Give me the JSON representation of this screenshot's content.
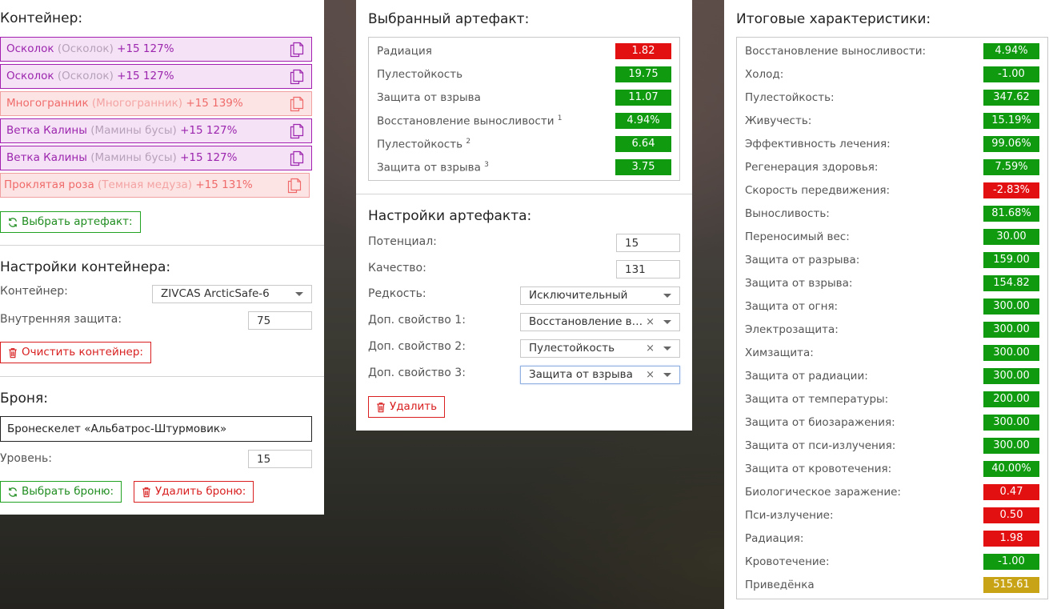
{
  "container": {
    "title": "Контейнер:",
    "artifacts": [
      {
        "name": "Осколок",
        "sub": "(Осколок)",
        "bonus": "+15 127%",
        "style": "purple"
      },
      {
        "name": "Осколок",
        "sub": "(Осколок)",
        "bonus": "+15 127%",
        "style": "purple"
      },
      {
        "name": "Многогранник",
        "sub": "(Многогранник)",
        "bonus": "+15 139%",
        "style": "pink"
      },
      {
        "name": "Ветка Калины",
        "sub": "(Мамины бусы)",
        "bonus": "+15 127%",
        "style": "purple"
      },
      {
        "name": "Ветка Калины",
        "sub": "(Мамины бусы)",
        "bonus": "+15 127%",
        "style": "purple"
      },
      {
        "name": "Проклятая роза",
        "sub": "(Темная медуза)",
        "bonus": "+15 131%",
        "style": "pink"
      }
    ],
    "select_artifact_label": "Выбрать артефакт:"
  },
  "container_settings": {
    "title": "Настройки контейнера:",
    "container_label": "Контейнер:",
    "container_value": "ZIVCAS ArcticSafe-6",
    "inner_protection_label": "Внутренняя защита:",
    "inner_protection_value": "75",
    "clear_label": "Очистить контейнер:"
  },
  "armor": {
    "title": "Броня:",
    "name": "Бронескелет «Альбатрос-Штурмовик»",
    "level_label": "Уровень:",
    "level_value": "15",
    "select_label": "Выбрать броню:",
    "delete_label": "Удалить броню:"
  },
  "selected_artifact": {
    "title": "Выбранный артефакт:",
    "stats": [
      {
        "label": "Радиация",
        "sup": "",
        "value": "1.82",
        "color": "red"
      },
      {
        "label": "Пулестойкость",
        "sup": "",
        "value": "19.75",
        "color": "green"
      },
      {
        "label": "Защита от взрыва",
        "sup": "",
        "value": "11.07",
        "color": "green"
      },
      {
        "label": "Восстановление выносливости",
        "sup": "1",
        "value": "4.94%",
        "color": "green"
      },
      {
        "label": "Пулестойкость",
        "sup": "2",
        "value": "6.64",
        "color": "green"
      },
      {
        "label": "Защита от взрыва",
        "sup": "3",
        "value": "3.75",
        "color": "green"
      }
    ]
  },
  "artifact_settings": {
    "title": "Настройки артефакта:",
    "potential_label": "Потенциал:",
    "potential_value": "15",
    "quality_label": "Качество:",
    "quality_value": "131",
    "rarity_label": "Редкость:",
    "rarity_value": "Исключительный",
    "prop1_label": "Доп. свойство 1:",
    "prop1_value": "Восстановление выносливости",
    "prop2_label": "Доп. свойство 2:",
    "prop2_value": "Пулестойкость",
    "prop3_label": "Доп. свойство 3:",
    "prop3_value": "Защита от взрыва",
    "delete_label": "Удалить",
    "clear_glyph": "×"
  },
  "totals": {
    "title": "Итоговые характеристики:",
    "stats": [
      {
        "label": "Восстановление выносливости:",
        "value": "4.94%",
        "color": "green"
      },
      {
        "label": "Холод:",
        "value": "-1.00",
        "color": "green"
      },
      {
        "label": "Пулестойкость:",
        "value": "347.62",
        "color": "green"
      },
      {
        "label": "Живучесть:",
        "value": "15.19%",
        "color": "green"
      },
      {
        "label": "Эффективность лечения:",
        "value": "99.06%",
        "color": "green"
      },
      {
        "label": "Регенерация здоровья:",
        "value": "7.59%",
        "color": "green"
      },
      {
        "label": "Скорость передвижения:",
        "value": "-2.83%",
        "color": "red"
      },
      {
        "label": "Выносливость:",
        "value": "81.68%",
        "color": "green"
      },
      {
        "label": "Переносимый вес:",
        "value": "30.00",
        "color": "green"
      },
      {
        "label": "Защита от разрыва:",
        "value": "159.00",
        "color": "green"
      },
      {
        "label": "Защита от взрыва:",
        "value": "154.82",
        "color": "green"
      },
      {
        "label": "Защита от огня:",
        "value": "300.00",
        "color": "green"
      },
      {
        "label": "Электрозащита:",
        "value": "300.00",
        "color": "green"
      },
      {
        "label": "Химзащита:",
        "value": "300.00",
        "color": "green"
      },
      {
        "label": "Защита от радиации:",
        "value": "300.00",
        "color": "green"
      },
      {
        "label": "Защита от температуры:",
        "value": "200.00",
        "color": "green"
      },
      {
        "label": "Защита от биозаражения:",
        "value": "300.00",
        "color": "green"
      },
      {
        "label": "Защита от пси-излучения:",
        "value": "300.00",
        "color": "green"
      },
      {
        "label": "Защита от кровотечения:",
        "value": "40.00%",
        "color": "green"
      },
      {
        "label": "Биологическое заражение:",
        "value": "0.47",
        "color": "red"
      },
      {
        "label": "Пси-излучение:",
        "value": "0.50",
        "color": "red"
      },
      {
        "label": "Радиация:",
        "value": "1.98",
        "color": "red"
      },
      {
        "label": "Кровотечение:",
        "value": "-1.00",
        "color": "green"
      },
      {
        "label": "Приведёнка",
        "value": "515.61",
        "color": "yellow"
      }
    ]
  },
  "colors": {
    "green": "#0f9a0f",
    "red": "#e21010",
    "yellow": "#c8a316",
    "artifact_purple": "#9c26ad",
    "artifact_pink": "#ef6b6b"
  }
}
